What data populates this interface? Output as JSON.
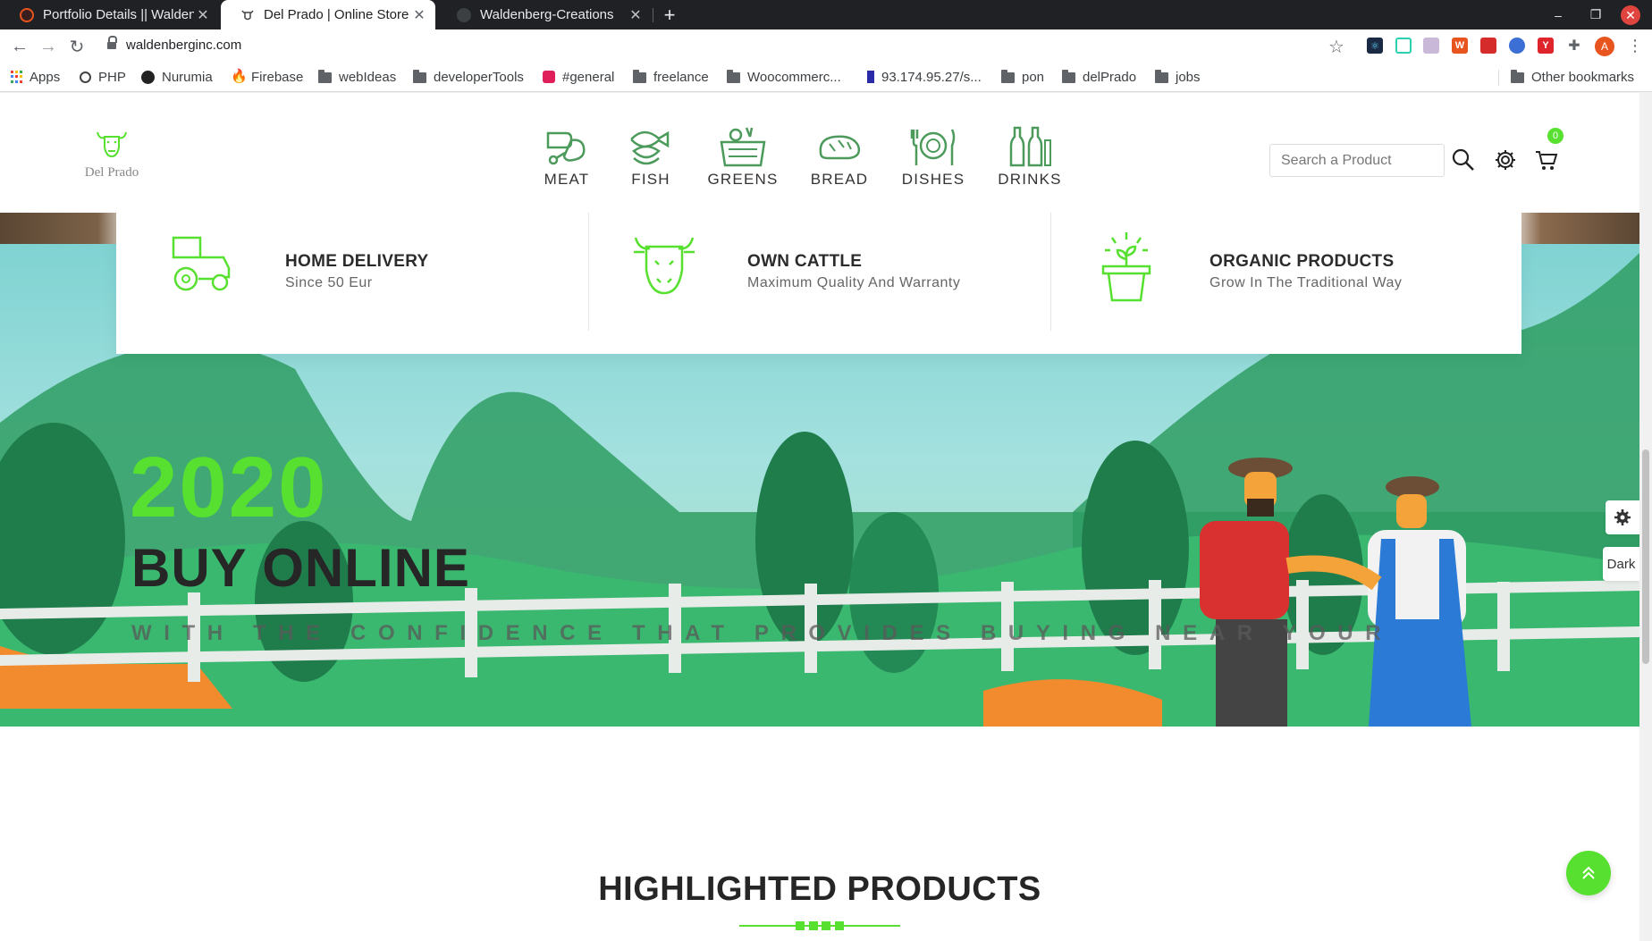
{
  "browser": {
    "tabs": [
      {
        "title": "Portfolio Details || Waldenberg",
        "active": false
      },
      {
        "title": "Del Prado | Online Store",
        "active": true
      },
      {
        "title": "Waldenberg-Creations",
        "active": false
      }
    ],
    "url": "waldenberginc.com",
    "profile_initial": "A",
    "bookmarks": [
      "Apps",
      "PHP",
      "Nurumia",
      "Firebase",
      "webIdeas",
      "developerTools",
      "#general",
      "freelance",
      "Woocommerc...",
      "93.174.95.27/s...",
      "pon",
      "delPrado",
      "jobs"
    ],
    "other_bookmarks": "Other bookmarks"
  },
  "header": {
    "logo_text": "Del Prado",
    "categories": [
      "MEAT",
      "FISH",
      "GREENS",
      "BREAD",
      "DISHES",
      "DRINKS"
    ],
    "search_placeholder": "Search a Product",
    "cart_count": "0"
  },
  "features": [
    {
      "title": "HOME DELIVERY",
      "subtitle": "Since 50 Eur",
      "icon": "tractor-icon"
    },
    {
      "title": "OWN CATTLE",
      "subtitle": "Maximum Quality And Warranty",
      "icon": "cow-icon"
    },
    {
      "title": "ORGANIC PRODUCTS",
      "subtitle": "Grow In The Traditional Way",
      "icon": "plant-pot-icon"
    }
  ],
  "hero": {
    "year": "2020",
    "title": "BUY ONLINE",
    "subtitle": "WITH THE CONFIDENCE THAT PROVIDES BUYING NEAR YOUR"
  },
  "side_panel": {
    "dark_label": "Dark"
  },
  "section": {
    "title": "HIGHLIGHTED PRODUCTS"
  },
  "colors": {
    "accent": "#57e02f",
    "text": "#262626"
  }
}
